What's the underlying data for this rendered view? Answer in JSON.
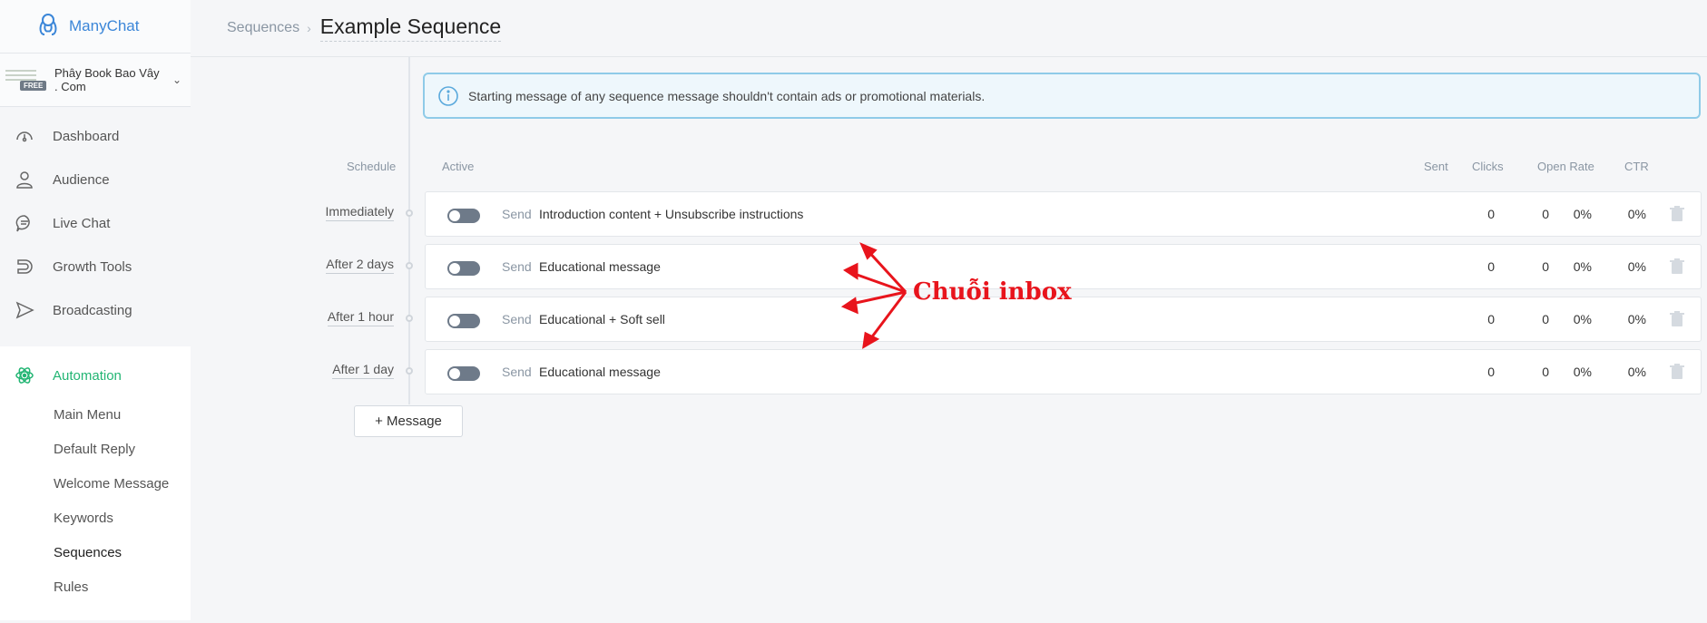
{
  "brand": {
    "name": "ManyChat",
    "accent": "#3b86d8"
  },
  "page": {
    "name": "Phây Book Bao Vây . Com",
    "badge": "FREE"
  },
  "nav": [
    {
      "label": "Dashboard",
      "icon": "dashboard-icon"
    },
    {
      "label": "Audience",
      "icon": "user-icon"
    },
    {
      "label": "Live Chat",
      "icon": "chat-icon"
    },
    {
      "label": "Growth Tools",
      "icon": "magnet-icon"
    },
    {
      "label": "Broadcasting",
      "icon": "send-icon"
    }
  ],
  "automation": {
    "label": "Automation",
    "color": "#22b573",
    "items": [
      "Main Menu",
      "Default Reply",
      "Welcome Message",
      "Keywords",
      "Sequences",
      "Rules"
    ],
    "current": "Sequences"
  },
  "breadcrumb": {
    "parent": "Sequences",
    "separator": "›",
    "title": "Example Sequence"
  },
  "info": "Starting message of any sequence message shouldn't contain ads or promotional materials.",
  "columns": {
    "schedule": "Schedule",
    "active": "Active",
    "sent": "Sent",
    "clicks": "Clicks",
    "open_rate": "Open Rate",
    "ctr": "CTR"
  },
  "rows": [
    {
      "schedule": "Immediately",
      "send": "Send",
      "message": "Introduction content + Unsubscribe instructions",
      "sent": "0",
      "clicks": "0",
      "open_rate": "0%",
      "ctr": "0%"
    },
    {
      "schedule": "After 2 days",
      "send": "Send",
      "message": "Educational message",
      "sent": "0",
      "clicks": "0",
      "open_rate": "0%",
      "ctr": "0%"
    },
    {
      "schedule": "After 1 hour",
      "send": "Send",
      "message": "Educational + Soft sell",
      "sent": "0",
      "clicks": "0",
      "open_rate": "0%",
      "ctr": "0%"
    },
    {
      "schedule": "After 1 day",
      "send": "Send",
      "message": "Educational message",
      "sent": "0",
      "clicks": "0",
      "open_rate": "0%",
      "ctr": "0%"
    }
  ],
  "add_message": "+ Message",
  "annotation": {
    "text": "Chuỗi inbox",
    "color": "#e8141c"
  }
}
